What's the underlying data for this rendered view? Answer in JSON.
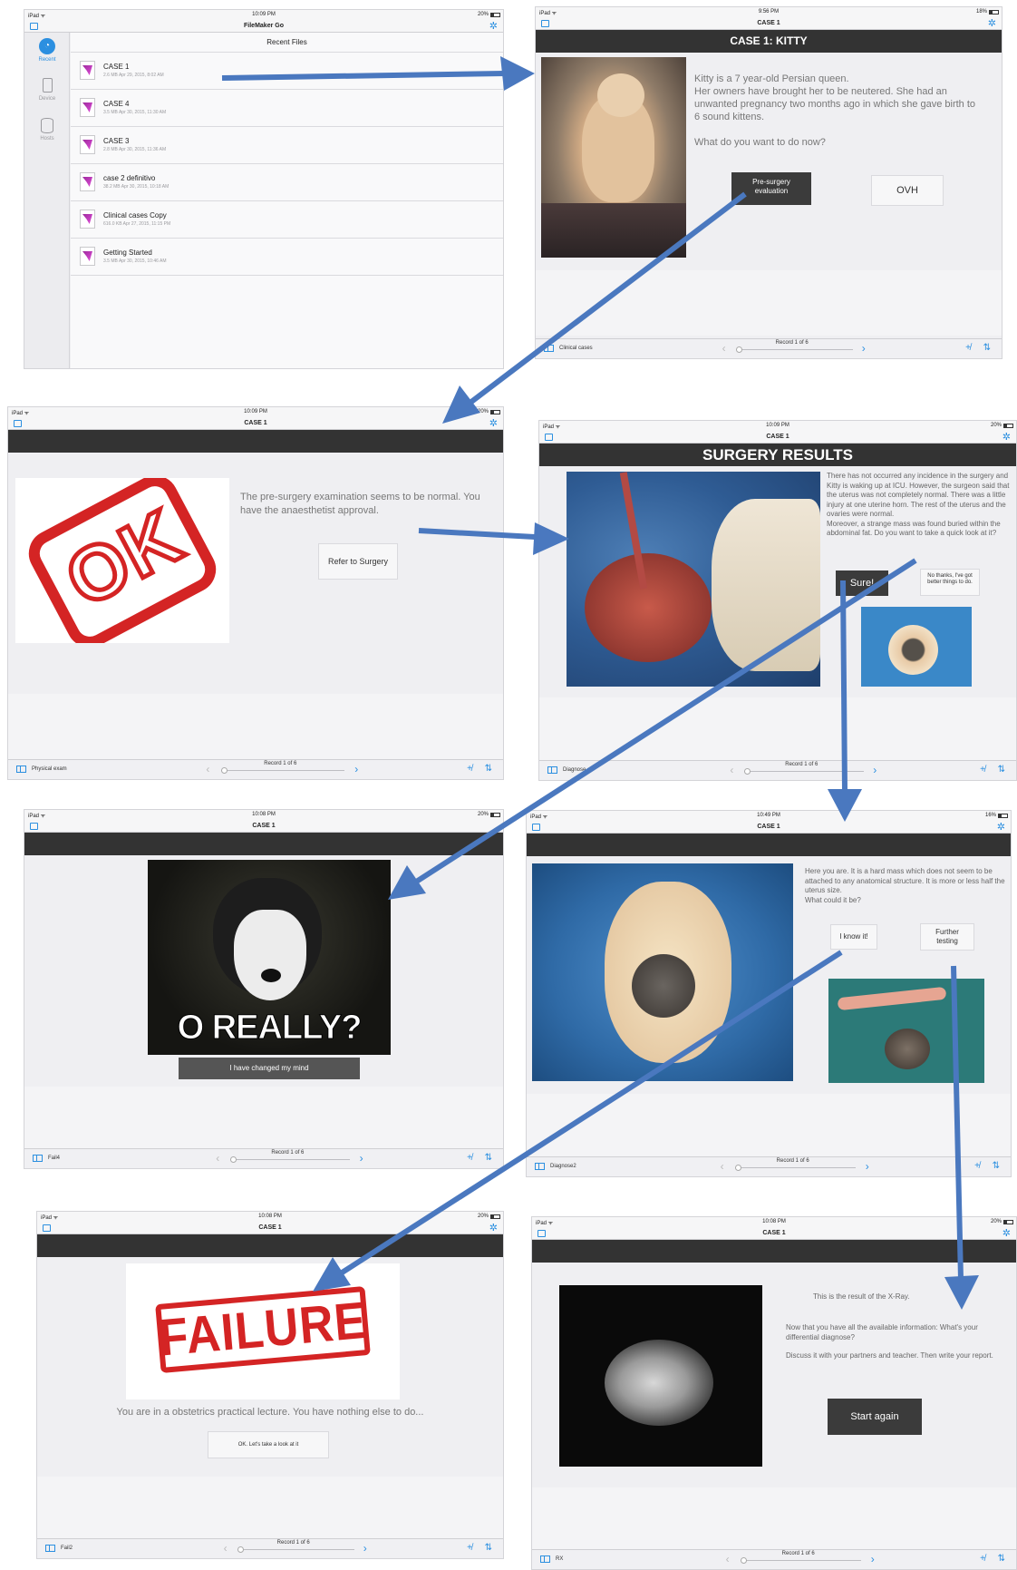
{
  "screens": {
    "filemaker": {
      "status_left": "iPad ᯤ",
      "status_time": "10:09 PM",
      "status_battery": "20%",
      "app_title": "FileMaker Go",
      "section_title": "Recent Files",
      "sidebar": [
        {
          "label": "Recent",
          "icon": "clock-icon"
        },
        {
          "label": "Device",
          "icon": "tablet-icon"
        },
        {
          "label": "Hosts",
          "icon": "database-icon"
        }
      ],
      "files": [
        {
          "name": "CASE 1",
          "meta": "2.6 MB Apr 29, 2015, 8:02 AM"
        },
        {
          "name": "CASE 4",
          "meta": "3.5 MB Apr 30, 2015, 11:30 AM"
        },
        {
          "name": "CASE 3",
          "meta": "2.8 MB Apr 30, 2015, 11:36 AM"
        },
        {
          "name": "case 2 definitivo",
          "meta": "38.2 MB Apr 30, 2015, 10:18 AM"
        },
        {
          "name": "Clinical cases Copy",
          "meta": "616.0 KB Apr 27, 2015, 11:15 PM"
        },
        {
          "name": "Getting Started",
          "meta": "3.5 MB Apr 30, 2015, 10:46 AM"
        }
      ]
    },
    "kitty": {
      "status_left": "iPad ᯤ",
      "status_time": "9:56 PM",
      "status_battery": "18%",
      "title": "CASE 1",
      "header": "CASE 1: KITTY",
      "description": "Kitty is a 7 year-old Persian queen.\nHer owners have brought her to be neutered. She had an unwanted pregnancy two months ago in which she gave birth to 6 sound kittens.",
      "question": "What do you want to do now?",
      "btn_pre": "Pre-surgery evaluation",
      "btn_ovh": "OVH",
      "layout_name": "Clinical cases",
      "record": "Record 1 of 6"
    },
    "ok": {
      "status_left": "iPad ᯤ",
      "status_time": "10:09 PM",
      "status_battery": "20%",
      "title": "CASE 1",
      "stamp": "OK",
      "text": "The pre-surgery examination seems to be normal. You have the anaesthetist approval.",
      "btn": "Refer to Surgery",
      "layout_name": "Physical exam",
      "record": "Record 1 of 6"
    },
    "surgery": {
      "status_left": "iPad ᯤ",
      "status_time": "10:09 PM",
      "status_battery": "20%",
      "title": "CASE 1",
      "header": "SURGERY RESULTS",
      "text": "There has not occurred any incidence in the surgery and Kitty is waking up at ICU. However, the surgeon said that the uterus was not completely normal. There was a little injury at one uterine horn. The rest of the uterus and the ovaries were normal.\nMoreover, a strange mass was found buried within the abdominal fat. Do you want to take a quick look at it?",
      "btn_sure": "Sure!",
      "btn_no": "No thanks, I've got better things to do.",
      "layout_name": "Diagnose",
      "record": "Record 1 of 6"
    },
    "oreally": {
      "status_left": "iPad ᯤ",
      "status_time": "10:08 PM",
      "status_battery": "20%",
      "title": "CASE 1",
      "meme_text": "O REALLY?",
      "btn": "I have changed my mind",
      "layout_name": "Fail4",
      "record": "Record 1 of 6"
    },
    "mass": {
      "status_left": "iPad ᯤ",
      "status_time": "10:49 PM",
      "status_battery": "16%",
      "title": "CASE 1",
      "text": "Here you are. It is a hard mass which does not seem to be attached to any anatomical structure. It is more or less half the uterus size.\nWhat could it be?",
      "btn_know": "I know it!",
      "btn_further": "Further testing",
      "layout_name": "Diagnose2",
      "record": "Record 1 of 6"
    },
    "failure": {
      "status_left": "iPad ᯤ",
      "status_time": "10:08 PM",
      "status_battery": "20%",
      "title": "CASE 1",
      "stamp": "FAILURE",
      "text": "You are in a obstetrics practical lecture. You have nothing else to do...",
      "btn": "OK. Let's take a look at it",
      "layout_name": "Fail2",
      "record": "Record 1 of 6"
    },
    "xray": {
      "status_left": "iPad ᯤ",
      "status_time": "10:08 PM",
      "status_battery": "20%",
      "title": "CASE 1",
      "text1": "This is the result of the X-Ray.",
      "text2": "Now that you have all the available information: What's your differential diagnose?",
      "text3": "Discuss it with your partners and teacher. Then write your report.",
      "btn": "Start again",
      "layout_name": "RX",
      "record": "Record 1 of 6"
    }
  },
  "colors": {
    "arrow": "#4a78bf",
    "accent": "#2b8fe0",
    "dark_bar": "#333333",
    "stamp_red": "#d42424"
  }
}
